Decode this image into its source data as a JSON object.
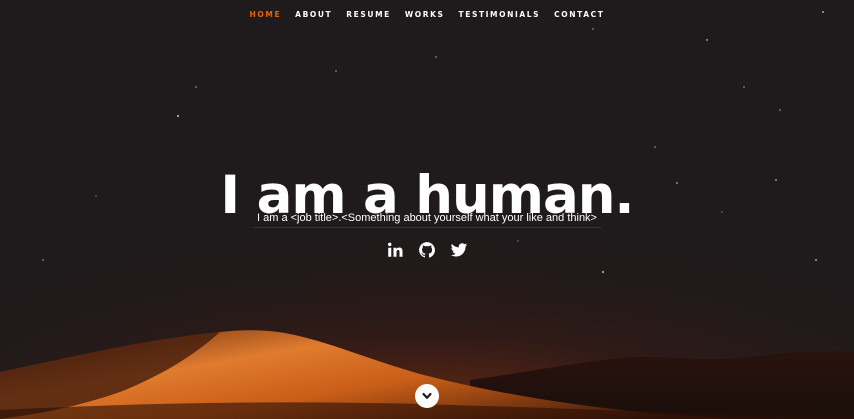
{
  "nav": {
    "items": [
      {
        "label": "HOME",
        "active": true
      },
      {
        "label": "ABOUT",
        "active": false
      },
      {
        "label": "RESUME",
        "active": false
      },
      {
        "label": "WORKS",
        "active": false
      },
      {
        "label": "TESTIMONIALS",
        "active": false
      },
      {
        "label": "CONTACT",
        "active": false
      }
    ]
  },
  "hero": {
    "headline": "I am a human.",
    "tagline": "I am a <job title>.<Something about yourself what your like and think>"
  },
  "social": {
    "icons": [
      "linkedin-icon",
      "github-icon",
      "twitter-icon"
    ]
  },
  "colors": {
    "accent": "#f06000",
    "background": "#1f1a1b",
    "dune": "#c8621e"
  },
  "scroll": {
    "icon": "chevron-down-icon"
  }
}
